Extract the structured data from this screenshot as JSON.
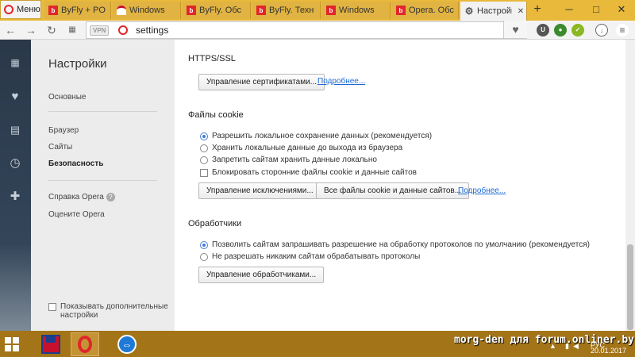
{
  "browser": {
    "menu_label": "Меню",
    "tabs": [
      {
        "label": "ByFly + PO",
        "icon": "byfly-favicon"
      },
      {
        "label": "Windows",
        "icon": "arc-favicon"
      },
      {
        "label": "ByFly. Обс",
        "icon": "byfly-favicon"
      },
      {
        "label": "ByFly. Техн",
        "icon": "byfly-favicon"
      },
      {
        "label": "Windows",
        "icon": "windows-favicon"
      },
      {
        "label": "Opera. Обс",
        "icon": "byfly-favicon"
      },
      {
        "label": "Настройки",
        "icon": "gear-icon",
        "active": true
      }
    ],
    "new_tab": "+",
    "window_controls": {
      "minimize": "─",
      "maximize": "□",
      "close": "✕"
    }
  },
  "addressbar": {
    "vpn_label": "VPN",
    "url": "settings"
  },
  "settings": {
    "title": "Настройки",
    "nav": {
      "basic": "Основные",
      "browser": "Браузер",
      "sites": "Сайты",
      "security": "Безопасность",
      "help": "Справка Opera",
      "rate": "Оцените Opera"
    },
    "show_advanced": "Показывать дополнительные настройки"
  },
  "content": {
    "https": {
      "title": "HTTPS/SSL",
      "manage_certs": "Управление сертификатами...",
      "more": "Подробнее..."
    },
    "cookies": {
      "title": "Файлы cookie",
      "options": [
        {
          "label": "Разрешить локальное сохранение данных (рекомендуется)",
          "checked": true
        },
        {
          "label": "Хранить локальные данные до выхода из браузера",
          "checked": false
        },
        {
          "label": "Запретить сайтам хранить данные локально",
          "checked": false
        }
      ],
      "block_third_party": "Блокировать сторонние файлы cookie и данные сайтов",
      "block_third_party_checked": false,
      "manage_exceptions": "Управление исключениями...",
      "all_cookies": "Все файлы cookie и данные сайтов...",
      "more": "Подробнее..."
    },
    "handlers": {
      "title": "Обработчики",
      "options": [
        {
          "label": "Позволить сайтам запрашивать разрешение на обработку протоколов по умолчанию (рекомендуется)",
          "checked": true
        },
        {
          "label": "Не разрешать никаким сайтам обрабатывать протоколы",
          "checked": false
        }
      ],
      "manage_handlers": "Управление обработчиками..."
    }
  },
  "taskbar": {
    "watermark": "morg-den для forum.onliner.by",
    "lang": "РУС",
    "date": "20.01.2017"
  },
  "colors": {
    "tabbar": "#e8b93a",
    "opera_red": "#e0262b",
    "link": "#1e6bd6",
    "taskbar": "#a37418"
  }
}
